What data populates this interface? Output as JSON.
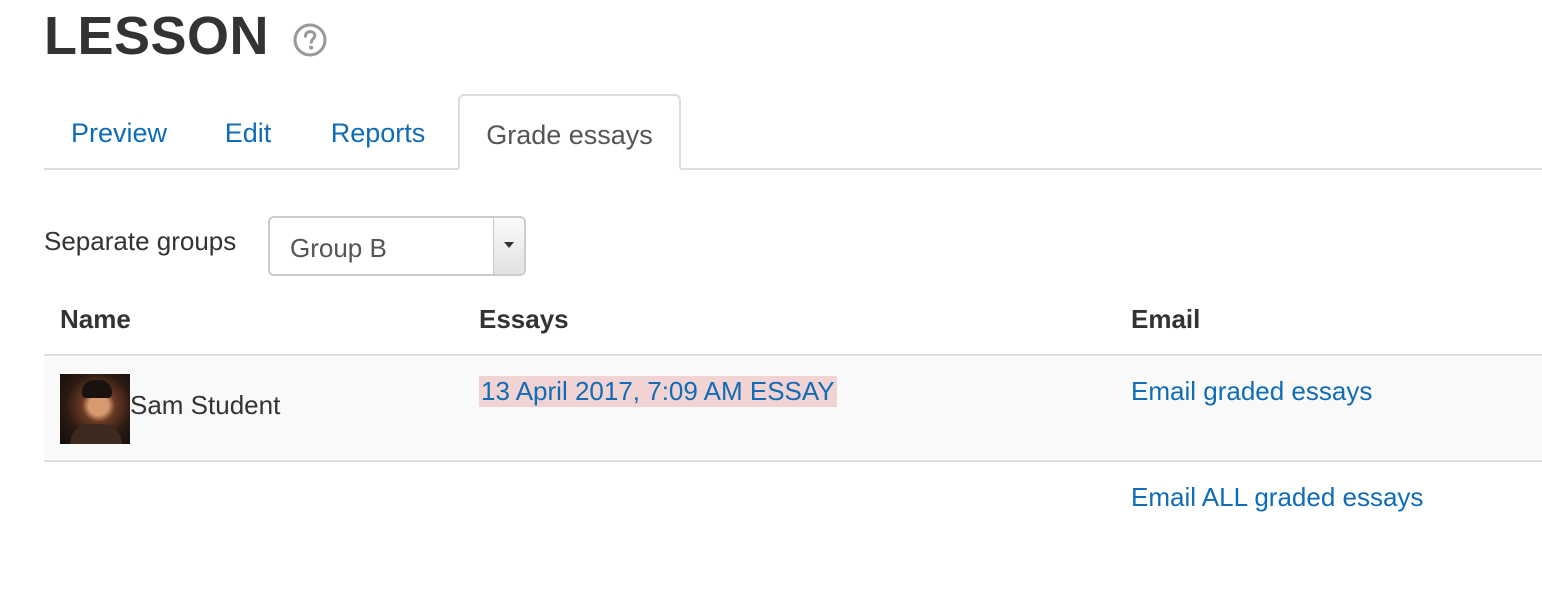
{
  "page": {
    "title": "LESSON",
    "help_icon": "question-circle-icon"
  },
  "tabs": [
    {
      "label": "Preview",
      "active": false
    },
    {
      "label": "Edit",
      "active": false
    },
    {
      "label": "Reports",
      "active": false
    },
    {
      "label": "Grade essays",
      "active": true
    }
  ],
  "group_filter": {
    "label": "Separate groups",
    "selected": "Group B"
  },
  "table": {
    "headers": [
      "Name",
      "Essays",
      "Email"
    ],
    "rows": [
      {
        "name": "Sam Student",
        "essay": "13 April 2017, 7:09 AM ESSAY",
        "email": "Email graded essays"
      }
    ]
  },
  "footer_actions": {
    "email_all": "Email ALL graded essays"
  },
  "colors": {
    "link": "#0f6cb5",
    "essay_highlight": "#f2d3d3",
    "row_background": "#f9f9f9",
    "border": "#dddddd"
  }
}
